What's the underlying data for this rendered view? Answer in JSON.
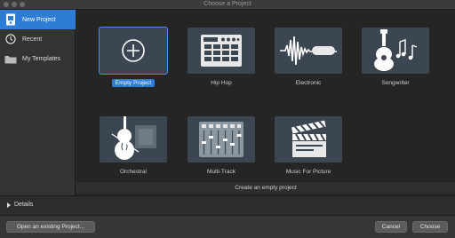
{
  "window": {
    "title": "Choose a Project"
  },
  "sidebar": {
    "items": [
      {
        "label": "New Project",
        "icon": "project-file-icon",
        "selected": true
      },
      {
        "label": "Recent",
        "icon": "recent-clock-icon",
        "selected": false
      },
      {
        "label": "My Templates",
        "icon": "folder-icon",
        "selected": false
      }
    ]
  },
  "templates": [
    {
      "label": "Empty Project",
      "icon": "plus-circle-icon",
      "selected": true
    },
    {
      "label": "Hip Hop",
      "icon": "drum-machine-icon",
      "selected": false
    },
    {
      "label": "Electronic",
      "icon": "waveform-icon",
      "selected": false
    },
    {
      "label": "Songwriter",
      "icon": "guitar-notes-icon",
      "selected": false
    },
    {
      "label": "Orchestral",
      "icon": "cello-icon",
      "selected": false
    },
    {
      "label": "Multi-Track",
      "icon": "mixer-icon",
      "selected": false
    },
    {
      "label": "Music For Picture",
      "icon": "clapperboard-icon",
      "selected": false
    }
  ],
  "status": {
    "description": "Create an empty project"
  },
  "details": {
    "label": "Details"
  },
  "footer": {
    "open_existing_label": "Open an existing Project...",
    "cancel_label": "Cancel",
    "choose_label": "Choose"
  },
  "colors": {
    "accent": "#2d7cd6",
    "tile_bg": "#3c4650",
    "window_bg": "#252525"
  }
}
